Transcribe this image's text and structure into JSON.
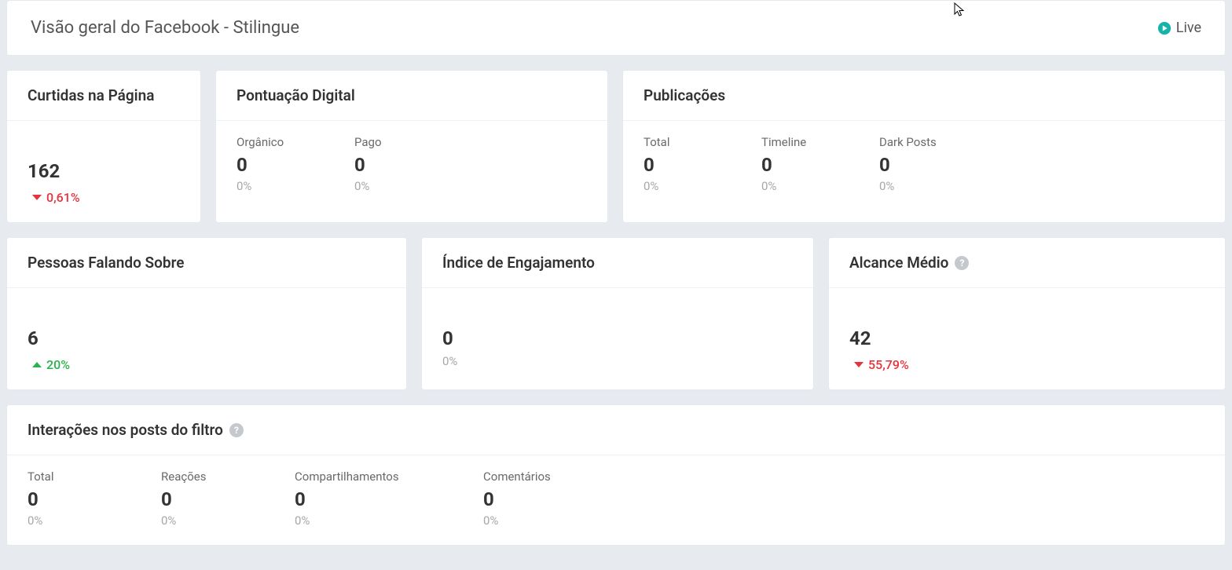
{
  "header": {
    "title": "Visão geral do Facebook - Stilingue",
    "live_label": "Live"
  },
  "colors": {
    "live_icon": "#16b3ac",
    "up": "#2bb24c",
    "down": "#e6333c"
  },
  "cards": {
    "page_likes": {
      "title": "Curtidas na Página",
      "value": "162",
      "delta": "0,61%",
      "direction": "down"
    },
    "digital_score": {
      "title": "Pontuação Digital",
      "metrics": [
        {
          "label": "Orgânico",
          "value": "0",
          "delta": "0%"
        },
        {
          "label": "Pago",
          "value": "0",
          "delta": "0%"
        }
      ]
    },
    "posts": {
      "title": "Publicações",
      "metrics": [
        {
          "label": "Total",
          "value": "0",
          "delta": "0%"
        },
        {
          "label": "Timeline",
          "value": "0",
          "delta": "0%"
        },
        {
          "label": "Dark Posts",
          "value": "0",
          "delta": "0%"
        }
      ]
    },
    "talking_about": {
      "title": "Pessoas Falando Sobre",
      "value": "6",
      "delta": "20%",
      "direction": "up"
    },
    "engagement_index": {
      "title": "Índice de Engajamento",
      "value": "0",
      "delta": "0%",
      "direction": "neutral"
    },
    "avg_reach": {
      "title": "Alcance Médio",
      "value": "42",
      "delta": "55,79%",
      "direction": "down",
      "has_help": true
    },
    "interactions": {
      "title": "Interações nos posts do filtro",
      "has_help": true,
      "metrics": [
        {
          "label": "Total",
          "value": "0",
          "delta": "0%"
        },
        {
          "label": "Reações",
          "value": "0",
          "delta": "0%"
        },
        {
          "label": "Compartilhamentos",
          "value": "0",
          "delta": "0%"
        },
        {
          "label": "Comentários",
          "value": "0",
          "delta": "0%"
        }
      ]
    }
  }
}
